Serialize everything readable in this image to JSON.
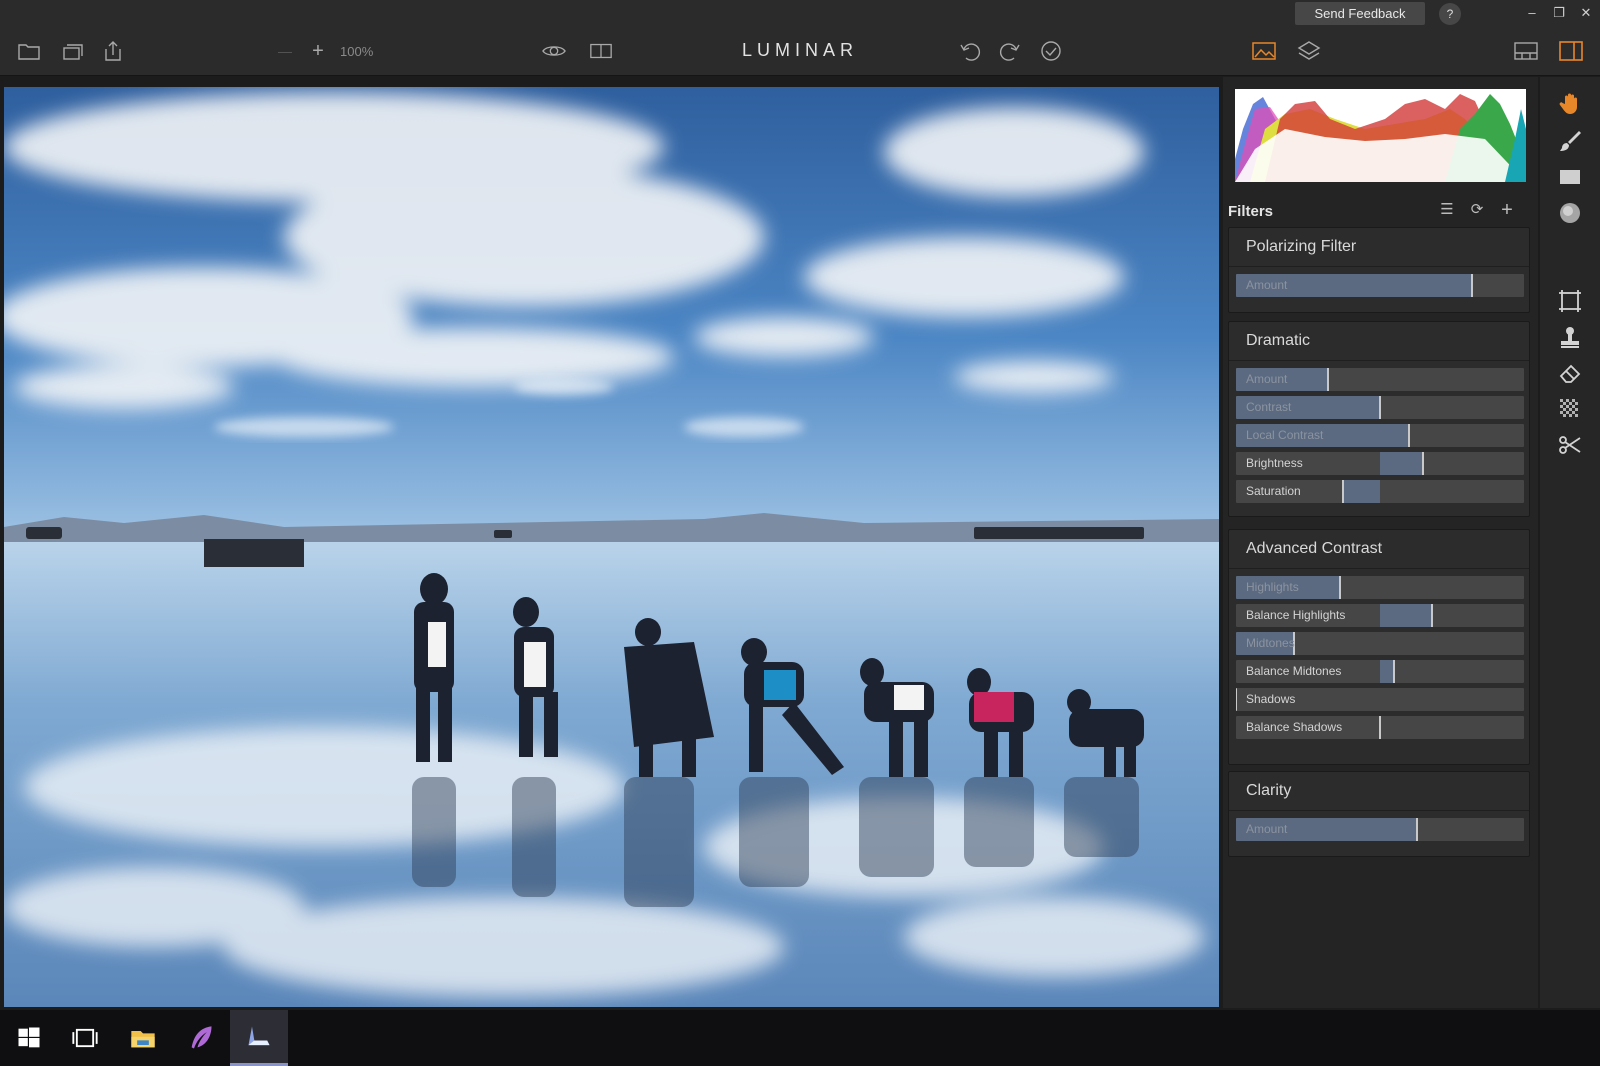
{
  "titlebar": {
    "send_feedback": "Send Feedback",
    "help": "?",
    "minimize": "–",
    "restore": "❐",
    "close": "✕"
  },
  "toolbar": {
    "zoom_out": "—",
    "zoom_in": "+",
    "zoom_level": "100%",
    "brand": "LUMINAR",
    "icons": [
      "folder-icon",
      "image-stack-icon",
      "share-icon",
      "eye-icon",
      "compare-icon",
      "undo-icon",
      "redo-icon",
      "check-icon",
      "histogram-toggle-icon",
      "layers-icon",
      "single-view-icon",
      "side-panel-icon"
    ]
  },
  "filters": {
    "title": "Filters",
    "cards": [
      {
        "title": "Polarizing Filter",
        "sliders": [
          {
            "label": "Amount",
            "value": 82,
            "dim": true
          }
        ]
      },
      {
        "title": "Dramatic",
        "sliders": [
          {
            "label": "Amount",
            "value": 32,
            "dim": true
          },
          {
            "label": "Contrast",
            "value": 50,
            "dim": true
          },
          {
            "label": "Local Contrast",
            "value": 60,
            "dim": true
          },
          {
            "label": "Brightness",
            "value": 65,
            "bipolar": true
          },
          {
            "label": "Saturation",
            "value": 37,
            "bipolar": true
          }
        ]
      },
      {
        "title": "Advanced Contrast",
        "sliders": [
          {
            "label": "Highlights",
            "value": 36,
            "dim": true
          },
          {
            "label": "Balance Highlights",
            "value": 68,
            "bipolar": true
          },
          {
            "label": "Midtones",
            "value": 20,
            "dim": true
          },
          {
            "label": "Balance Midtones",
            "value": 55,
            "bipolar": true
          },
          {
            "label": "Shadows",
            "value": 0,
            "dim": false
          },
          {
            "label": "Balance Shadows",
            "value": 50,
            "bipolar": true
          }
        ]
      },
      {
        "title": "Clarity",
        "sliders": [
          {
            "label": "Amount",
            "value": 63,
            "dim": true
          }
        ]
      }
    ]
  },
  "tools": [
    "hand-icon",
    "brush-icon",
    "gradient-icon",
    "radial-icon",
    "crop-icon",
    "clone-stamp-icon",
    "eraser-icon",
    "noise-icon",
    "transform-icon"
  ],
  "taskbar": [
    "windows-start-icon",
    "task-view-icon",
    "file-explorer-icon",
    "feather-app-icon",
    "luminar-app-icon"
  ],
  "colors": {
    "accent": "#e8862a",
    "slider_fill": "#5b6a80",
    "panel_bg": "#242424"
  }
}
